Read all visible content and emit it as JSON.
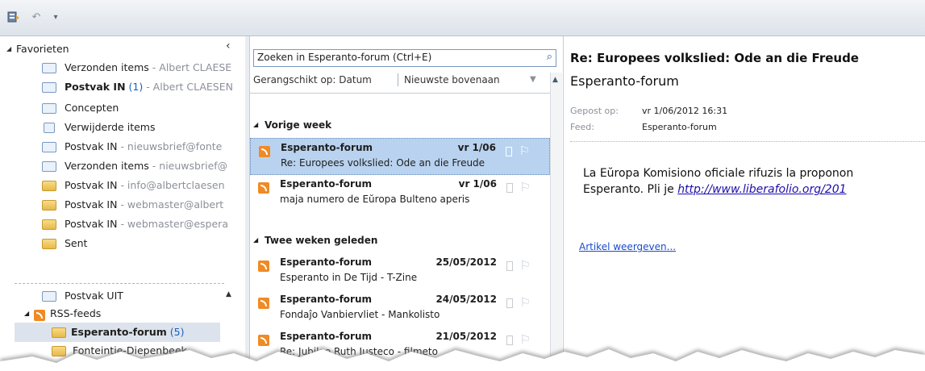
{
  "nav": {
    "favorites_label": "Favorieten",
    "items": [
      {
        "label": "Verzonden items",
        "sub": " - Albert CLAESE",
        "count": "",
        "bold": false,
        "icon": "sent-items-icon"
      },
      {
        "label": "Postvak IN",
        "sub": " - Albert CLAESEN",
        "count": " (1)",
        "bold": true,
        "icon": "inbox-icon"
      },
      {
        "label": "Concepten",
        "sub": "",
        "count": "",
        "bold": false,
        "icon": "drafts-icon"
      },
      {
        "label": "Verwijderde items",
        "sub": "",
        "count": "",
        "bold": false,
        "icon": "deleted-items-icon"
      },
      {
        "label": "Postvak IN",
        "sub": " - nieuwsbrief@fonte",
        "count": "",
        "bold": false,
        "icon": "inbox-icon"
      },
      {
        "label": "Verzonden items",
        "sub": " - nieuwsbrief@",
        "count": "",
        "bold": false,
        "icon": "sent-items-icon"
      },
      {
        "label": "Postvak IN",
        "sub": " - info@albertclaesen",
        "count": "",
        "bold": false,
        "icon": "folder-icon"
      },
      {
        "label": "Postvak IN",
        "sub": " - webmaster@albert",
        "count": "",
        "bold": false,
        "icon": "folder-icon"
      },
      {
        "label": "Postvak IN",
        "sub": " - webmaster@espera",
        "count": "",
        "bold": false,
        "icon": "folder-icon"
      },
      {
        "label": "Sent",
        "sub": "",
        "count": "",
        "bold": false,
        "icon": "folder-icon"
      }
    ],
    "outbox_label": "Postvak UIT",
    "rss_label": "RSS-feeds",
    "esperanto_label": "Esperanto-forum",
    "esperanto_count": " (5)",
    "fonteintje_label": "Fonteintje-Diepenbeek"
  },
  "list": {
    "search_placeholder": "Zoeken in Esperanto-forum (Ctrl+E)",
    "arranged_by": "Gerangschikt op: Datum",
    "sort_order": "Nieuwste bovenaan",
    "groups": [
      {
        "label": "Vorige week"
      },
      {
        "label": "Twee weken geleden"
      }
    ],
    "items": [
      {
        "from": "Esperanto-forum",
        "date": "vr 1/06",
        "subject": "Re: Europees volkslied: Ode an die Freude",
        "selected": true
      },
      {
        "from": "Esperanto-forum",
        "date": "vr 1/06",
        "subject": "maja numero de Eŭropa Bulteno aperis",
        "selected": false
      },
      {
        "from": "Esperanto-forum",
        "date": "25/05/2012",
        "subject": "Esperanto in De Tijd - T-Zine",
        "selected": false
      },
      {
        "from": "Esperanto-forum",
        "date": "24/05/2012",
        "subject": "Fondaĵo Vanbiervliet - Mankolisto",
        "selected": false
      },
      {
        "from": "Esperanto-forum",
        "date": "21/05/2012",
        "subject": "Re: Jubileo Ruth Justeco - filmeto",
        "selected": false
      }
    ]
  },
  "reading": {
    "title": "Re: Europees volkslied: Ode an die Freude",
    "feed_name": "Esperanto-forum",
    "posted_label": "Gepost op:",
    "posted_value": "vr 1/06/2012 16:31",
    "feed_label": "Feed:",
    "feed_value": "Esperanto-forum",
    "body_line1": "La Eŭropa Komisiono oficiale rifuzis la proponon",
    "body_line2_prefix": "Esperanto. Pli je ",
    "body_link": "http://www.liberafolio.org/201",
    "view_article": "Artikel weergeven..."
  },
  "colors": {
    "selected_bg": "#b9d2ef",
    "link": "#1a0dab",
    "count": "#1b5fbf"
  }
}
